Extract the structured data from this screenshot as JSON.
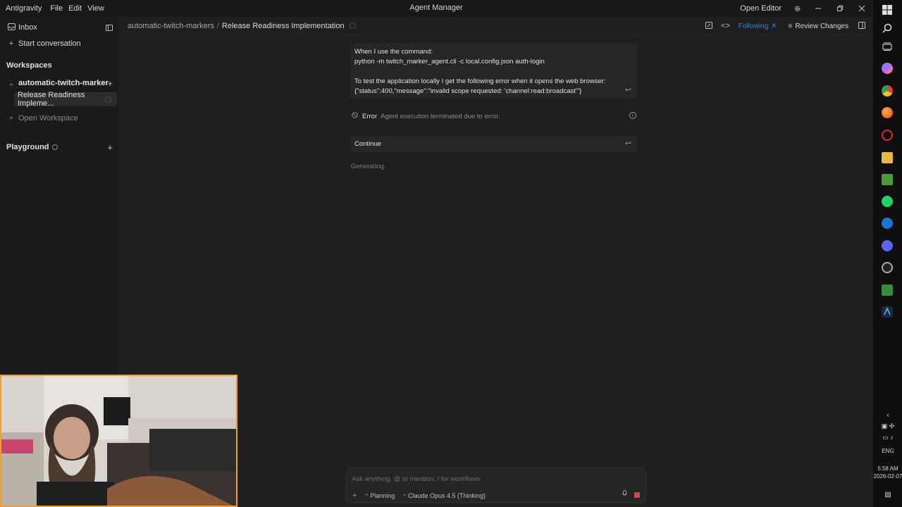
{
  "titlebar": {
    "menu": [
      "Antigravity",
      "File",
      "Edit",
      "View"
    ],
    "title": "Agent Manager",
    "open_editor": "Open Editor"
  },
  "sidebar": {
    "inbox": "Inbox",
    "start_conversation": "Start conversation",
    "workspaces_heading": "Workspaces",
    "workspace_name": "automatic-twitch-marker",
    "conversation": "Release Readiness Impleme...",
    "open_workspace": "Open Workspace",
    "playground_heading": "Playground"
  },
  "header": {
    "breadcrumb_workspace": "automatic-twitch-markers",
    "breadcrumb_sep": "/",
    "breadcrumb_current": "Release Readiness Implementation",
    "following": "Following",
    "review_changes": "Review Changes"
  },
  "conversation": {
    "message_lines": [
      "When I use the command:",
      "python -m twitch_marker_agent.cli -c local.config.json auth-login",
      "",
      "To test the application locally I get the following error when it opens the web browser:",
      "{\"status\":400,\"message\":\"invalid scope requested: 'channel:read:broadcast'\"}"
    ],
    "error_label": "Error",
    "error_message": "Agent execution terminated due to error.",
    "continue": "Continue",
    "generating": "Generating."
  },
  "composer": {
    "placeholder": "Ask anything, @ to mention, / for workflows",
    "mode": "Planning",
    "model": "Claude Opus 4.5 (Thinking)"
  },
  "tray": {
    "language": "ENG",
    "time": "5:58 AM",
    "date": "2026-02-07"
  },
  "colors": {
    "accent": "#3f7fd6",
    "stop": "#c94a4a",
    "webcam_border": "#f0a030"
  }
}
